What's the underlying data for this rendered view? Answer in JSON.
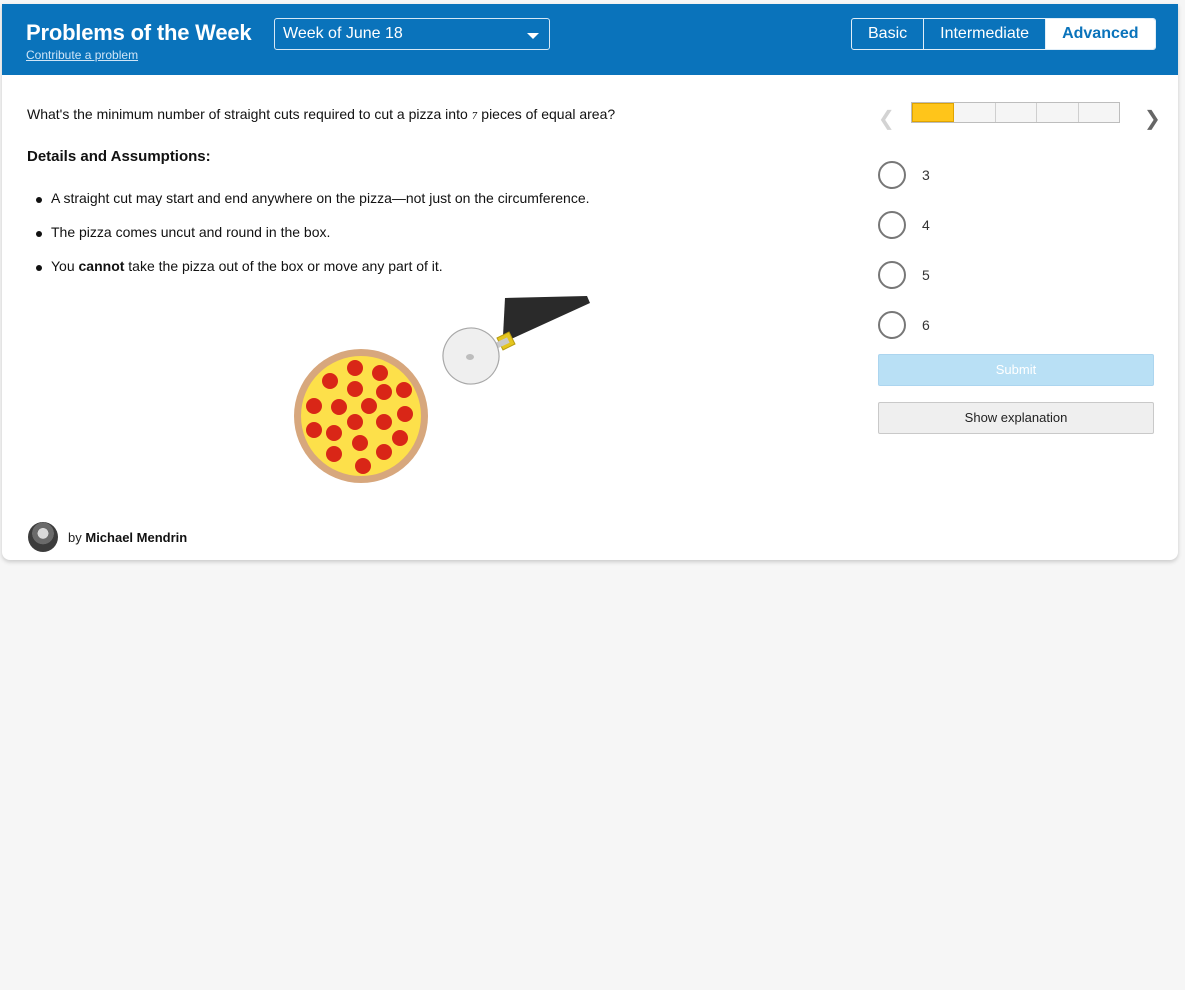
{
  "header": {
    "title": "Problems of the Week",
    "contribute_link": "Contribute a problem",
    "week_select": "Week of June 18",
    "levels": [
      {
        "label": "Basic",
        "active": false
      },
      {
        "label": "Intermediate",
        "active": false
      },
      {
        "label": "Advanced",
        "active": true
      }
    ]
  },
  "problem": {
    "question_before": "What's the minimum number of straight cuts required to cut a pizza into",
    "question_var": "7",
    "question_after": "pieces of equal area?",
    "details_title": "Details and Assumptions:",
    "bullets": {
      "b1": "A straight cut may start and end anywhere on the pizza—not just on the circumference.",
      "b2": "The pizza comes uncut and round in the box.",
      "b3_before": "You",
      "b3_bold": "cannot",
      "b3_after": "take the pizza out of the box or move any part of it."
    }
  },
  "author": {
    "by": "by",
    "name": "Michael Mendrin"
  },
  "progress": {
    "segments_total": 5,
    "segments_done": 1
  },
  "answers": {
    "options": [
      "3",
      "4",
      "5",
      "6"
    ]
  },
  "actions": {
    "submit": "Submit",
    "show_explanation": "Show explanation"
  },
  "colors": {
    "header_bg": "#0a73bb",
    "progress_fill": "#ffc51a",
    "submit_disabled": "#b9e0f5"
  },
  "icons": {
    "prev": "chevron-left-icon",
    "next": "chevron-right-icon",
    "dropdown": "caret-down-icon"
  }
}
